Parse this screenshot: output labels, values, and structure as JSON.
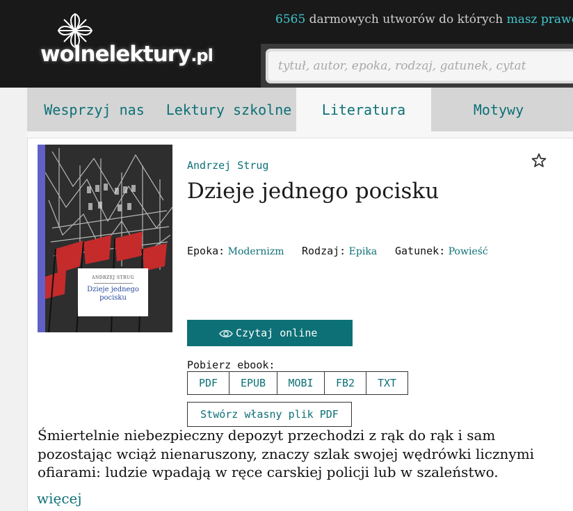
{
  "header": {
    "logo_text": "wolnelektury",
    "logo_suffix": ".pl",
    "tagline_count": "6565",
    "tagline_text": " darmowych utworów do których ",
    "tagline_link": "masz prawo",
    "search_placeholder": "tytuł, autor, epoka, rodzaj, gatunek, cytat"
  },
  "nav": {
    "items": [
      {
        "label": "Wesprzyj nas",
        "active": false
      },
      {
        "label": "Lektury szkolne",
        "active": false
      },
      {
        "label": "Literatura",
        "active": true
      },
      {
        "label": "Motywy",
        "active": false
      }
    ]
  },
  "book": {
    "cover": {
      "author": "ANDRZEJ STRUG",
      "title_line1": "Dzieje jednego",
      "title_line2": "pocisku"
    },
    "author": "Andrzej Strug",
    "title": "Dzieje jednego pocisku",
    "meta": [
      {
        "key": "Epoka:",
        "value": "Modernizm"
      },
      {
        "key": "Rodzaj:",
        "value": "Epika"
      },
      {
        "key": "Gatunek:",
        "value": "Powieść"
      }
    ],
    "read_online": "Czytaj online",
    "download_label": "Pobierz ebook:",
    "formats": [
      "PDF",
      "EPUB",
      "MOBI",
      "FB2",
      "TXT"
    ],
    "custom_pdf": "Stwórz własny plik PDF",
    "description": "Śmiertelnie niebezpieczny depozyt przechodzi z rąk do rąk i sam pozostając wciąż nienaruszony, znaczy szlak swojej wędrówki licznymi ofiarami: ludzie wpadają w ręce carskiej policji lub w szaleństwo.",
    "more": "więcej"
  },
  "colors": {
    "accent": "#0c7076",
    "header_bg": "#191919",
    "tagline_accent": "#42c6cf",
    "cover_bar": "#6060c8"
  }
}
